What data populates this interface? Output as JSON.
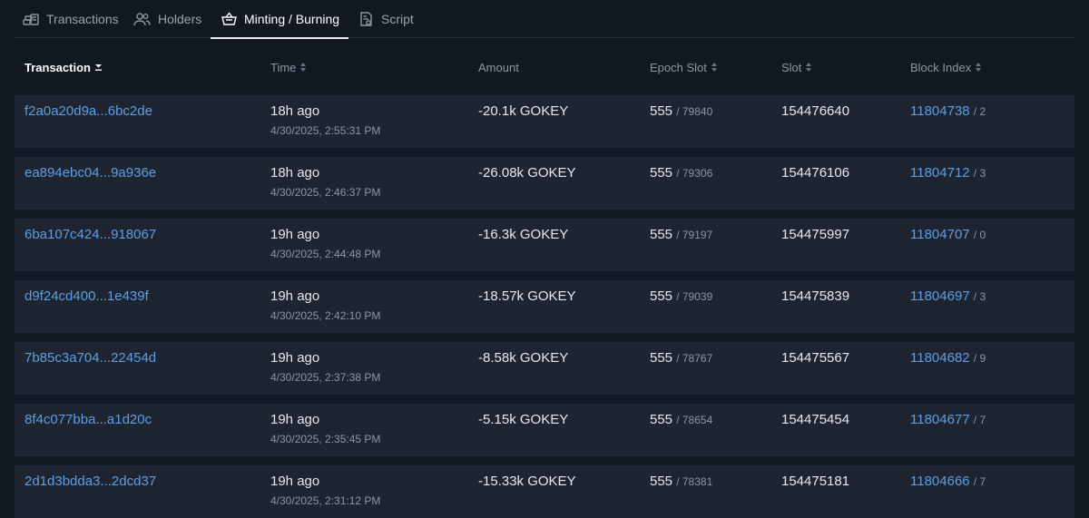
{
  "tabs": [
    {
      "label": "Transactions",
      "icon": "coins-icon",
      "active": false
    },
    {
      "label": "Holders",
      "icon": "users-icon",
      "active": false
    },
    {
      "label": "Minting / Burning",
      "icon": "basket-icon",
      "active": true
    },
    {
      "label": "Script",
      "icon": "script-icon",
      "active": false
    }
  ],
  "table": {
    "columns": [
      {
        "label": "Transaction",
        "sortable": true,
        "active": true
      },
      {
        "label": "Time",
        "sortable": true,
        "active": false
      },
      {
        "label": "Amount",
        "sortable": false,
        "active": false
      },
      {
        "label": "Epoch Slot",
        "sortable": true,
        "active": false
      },
      {
        "label": "Slot",
        "sortable": true,
        "active": false
      },
      {
        "label": "Block Index",
        "sortable": true,
        "active": false
      }
    ],
    "rows": [
      {
        "tx": "f2a0a20d9a...6bc2de",
        "ago": "18h ago",
        "datetime": "4/30/2025, 2:55:31 PM",
        "amount": "-20.1k GOKEY",
        "epoch": "555",
        "epoch_slot": "/ 79840",
        "slot": "154476640",
        "block": "11804738",
        "index": "/ 2"
      },
      {
        "tx": "ea894ebc04...9a936e",
        "ago": "18h ago",
        "datetime": "4/30/2025, 2:46:37 PM",
        "amount": "-26.08k GOKEY",
        "epoch": "555",
        "epoch_slot": "/ 79306",
        "slot": "154476106",
        "block": "11804712",
        "index": "/ 3"
      },
      {
        "tx": "6ba107c424...918067",
        "ago": "19h ago",
        "datetime": "4/30/2025, 2:44:48 PM",
        "amount": "-16.3k GOKEY",
        "epoch": "555",
        "epoch_slot": "/ 79197",
        "slot": "154475997",
        "block": "11804707",
        "index": "/ 0"
      },
      {
        "tx": "d9f24cd400...1e439f",
        "ago": "19h ago",
        "datetime": "4/30/2025, 2:42:10 PM",
        "amount": "-18.57k GOKEY",
        "epoch": "555",
        "epoch_slot": "/ 79039",
        "slot": "154475839",
        "block": "11804697",
        "index": "/ 3"
      },
      {
        "tx": "7b85c3a704...22454d",
        "ago": "19h ago",
        "datetime": "4/30/2025, 2:37:38 PM",
        "amount": "-8.58k GOKEY",
        "epoch": "555",
        "epoch_slot": "/ 78767",
        "slot": "154475567",
        "block": "11804682",
        "index": "/ 9"
      },
      {
        "tx": "8f4c077bba...a1d20c",
        "ago": "19h ago",
        "datetime": "4/30/2025, 2:35:45 PM",
        "amount": "-5.15k GOKEY",
        "epoch": "555",
        "epoch_slot": "/ 78654",
        "slot": "154475454",
        "block": "11804677",
        "index": "/ 7"
      },
      {
        "tx": "2d1d3bdda3...2dcd37",
        "ago": "19h ago",
        "datetime": "4/30/2025, 2:31:12 PM",
        "amount": "-15.33k GOKEY",
        "epoch": "555",
        "epoch_slot": "/ 78381",
        "slot": "154475181",
        "block": "11804666",
        "index": "/ 7"
      }
    ]
  },
  "colors": {
    "background": "#121821",
    "row": "#1e2530",
    "link": "#5c9ee6",
    "muted": "#8e96a1"
  }
}
